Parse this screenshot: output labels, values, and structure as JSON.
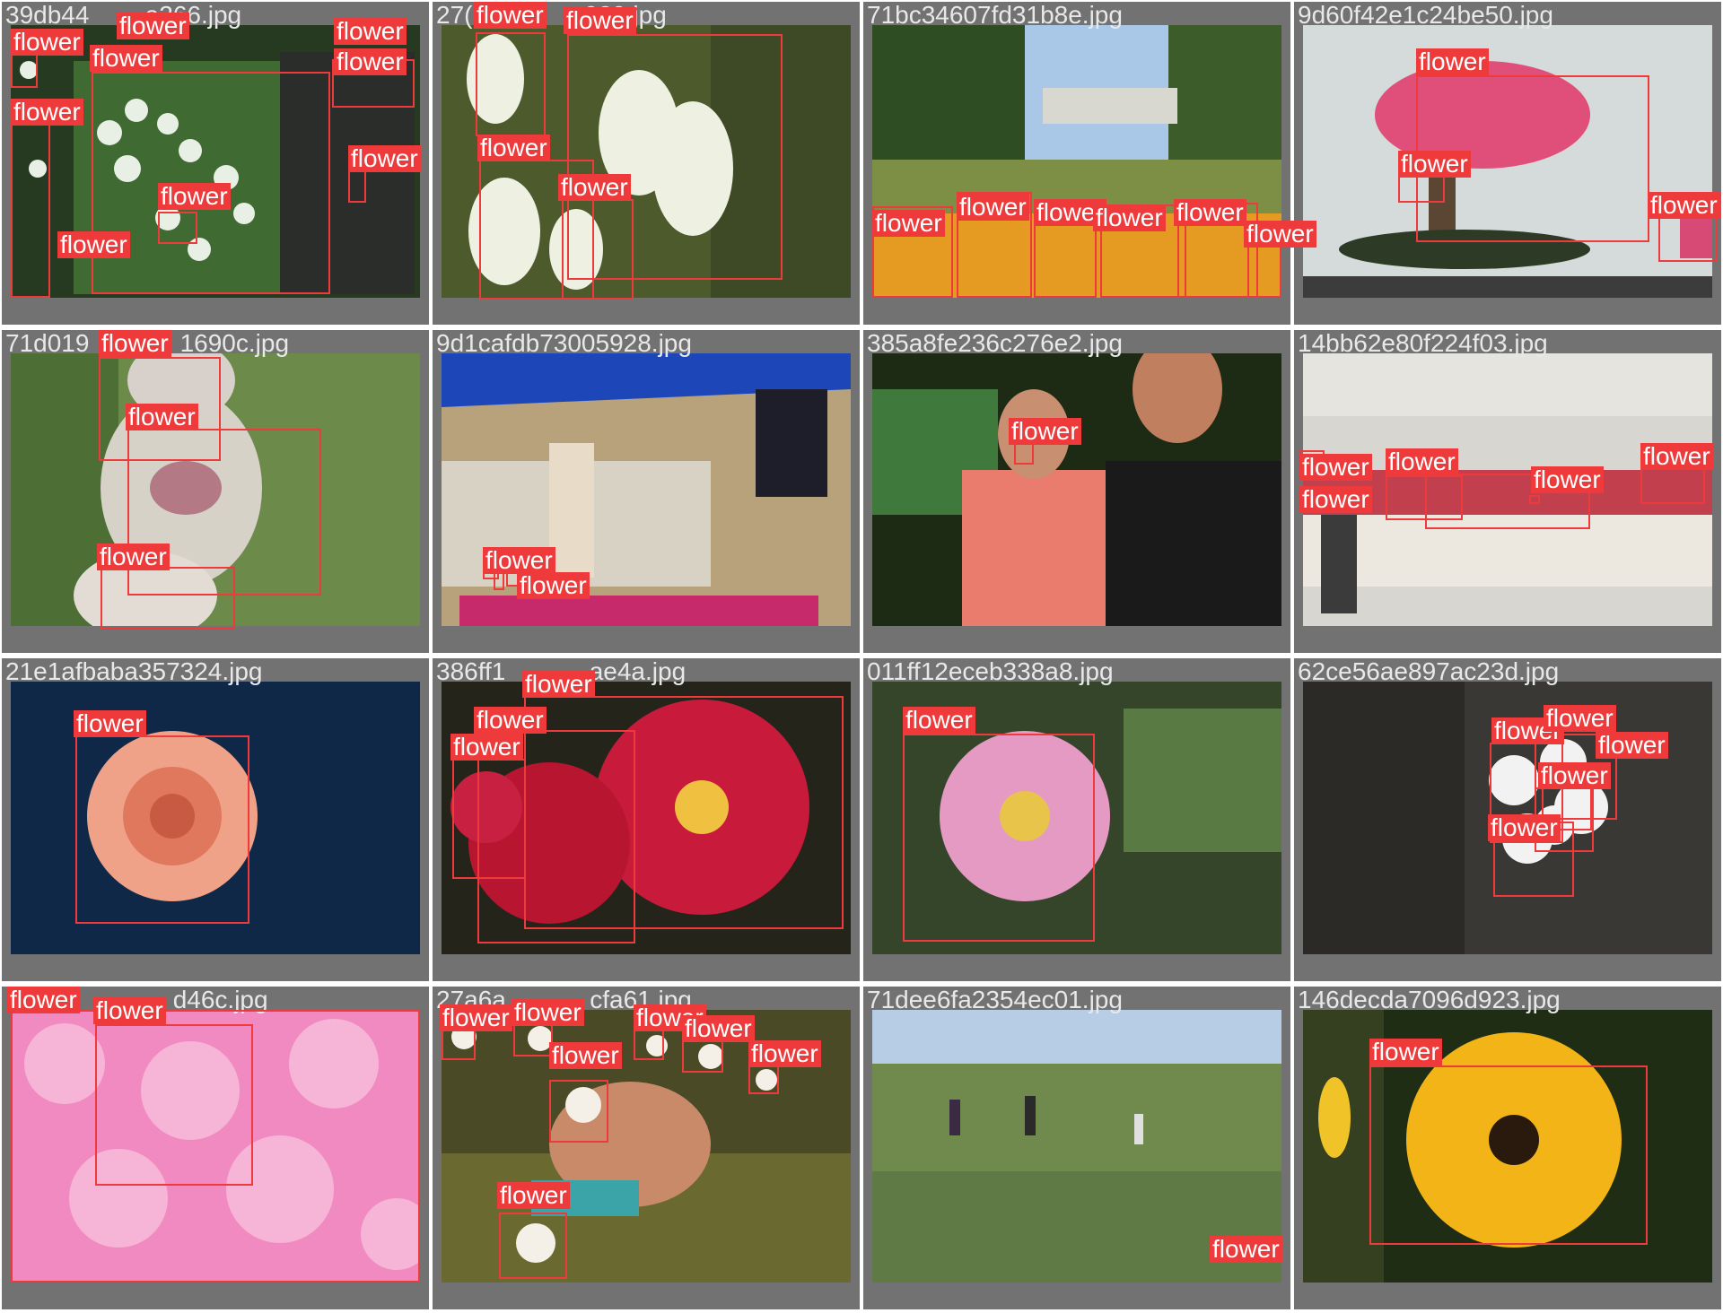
{
  "label_text": "flower",
  "colors": {
    "box": "#ee3a3a",
    "tile_bg": "#727272",
    "filename": "#e8e8e8"
  },
  "tiles": [
    {
      "filename": "39db44",
      "detections": 13
    },
    {
      "filename": "27(flower)929.jpg",
      "detections": 4
    },
    {
      "filename": "71bc34607fd31b8e.jpg",
      "detections": 6
    },
    {
      "filename": "9d60f42e1c24be50.jpg",
      "detections": 3
    },
    {
      "filename": "71d019",
      "detections": 3
    },
    {
      "filename": "9d1cafdb73005928.jpg",
      "detections": 4
    },
    {
      "filename": "385a8fe236c276e2.jpg",
      "detections": 1
    },
    {
      "filename": "14bb62e80f224f03.jpg",
      "detections": 5
    },
    {
      "filename": "21e1afbaba357324.jpg",
      "detections": 1
    },
    {
      "filename": "386ff1",
      "detections": 3
    },
    {
      "filename": "011ff12eceb338a8.jpg",
      "detections": 1
    },
    {
      "filename": "62ce56ae897ac23d.jpg",
      "detections": 5
    },
    {
      "filename": "",
      "detections": 2
    },
    {
      "filename": "27a6a",
      "detections": 7
    },
    {
      "filename": "71dee6fa2354ec01.jpg",
      "detections": 1
    },
    {
      "filename": "146decda7096d923.jpg",
      "detections": 1
    }
  ],
  "tile0": {
    "filename": "39db44",
    "suffix": "a266.jpg"
  },
  "tile1": {
    "filename": "27(",
    "suffix": "929.jpg"
  },
  "tile2": {
    "filename": "71bc34607fd31b8e.jpg"
  },
  "tile3": {
    "filename": "9d60f42e1c24be50.jpg"
  },
  "tile4": {
    "filename": "71d019",
    "suffix": "1690c.jpg"
  },
  "tile5": {
    "filename": "9d1cafdb73005928.jpg"
  },
  "tile6": {
    "filename": "385a8fe236c276e2.jpg"
  },
  "tile7": {
    "filename": "14bb62e80f224f03.jpg"
  },
  "tile8": {
    "filename": "21e1afbaba357324.jpg"
  },
  "tile9": {
    "filename": "386ff1",
    "suffix": "ae4a.jpg"
  },
  "tile10": {
    "filename": "011ff12eceb338a8.jpg"
  },
  "tile11": {
    "filename": "62ce56ae897ac23d.jpg"
  },
  "tile12": {
    "filename": "",
    "suffix": "d46c.jpg"
  },
  "tile13": {
    "filename": "27a6a",
    "suffix": "cfa61.jpg"
  },
  "tile14": {
    "filename": "71dee6fa2354ec01.jpg"
  },
  "tile15": {
    "filename": "146decda7096d923.jpg"
  }
}
